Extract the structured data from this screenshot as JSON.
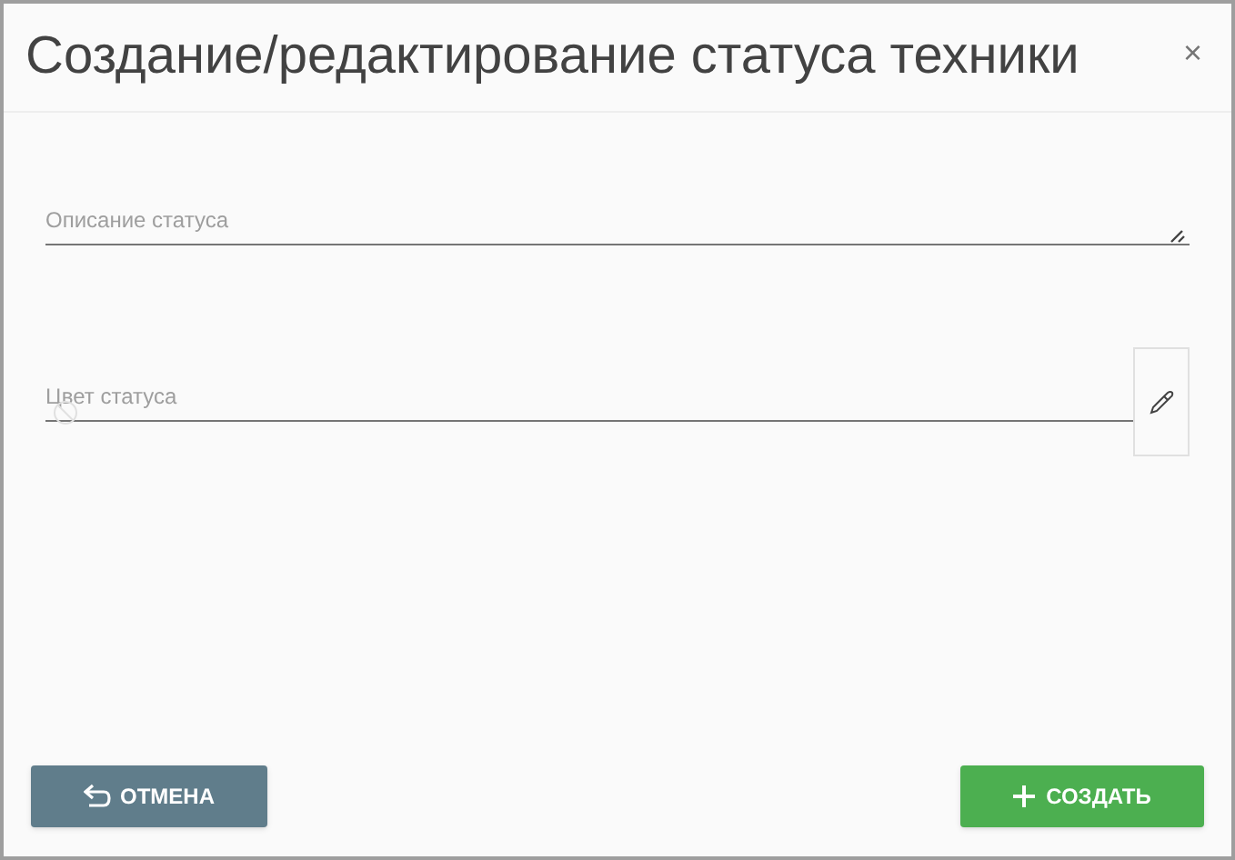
{
  "dialog": {
    "title": "Создание/редактирование статуса техники",
    "close": "×"
  },
  "fields": [
    {
      "kind": "textarea",
      "placeholder": "Описание статуса"
    },
    {
      "kind": "color",
      "placeholder": "Цвет статуса"
    }
  ],
  "buttons": [
    {
      "kind": "cancel",
      "label": "ОТМЕНА"
    },
    {
      "kind": "create",
      "label": "СОЗДАТЬ"
    }
  ]
}
